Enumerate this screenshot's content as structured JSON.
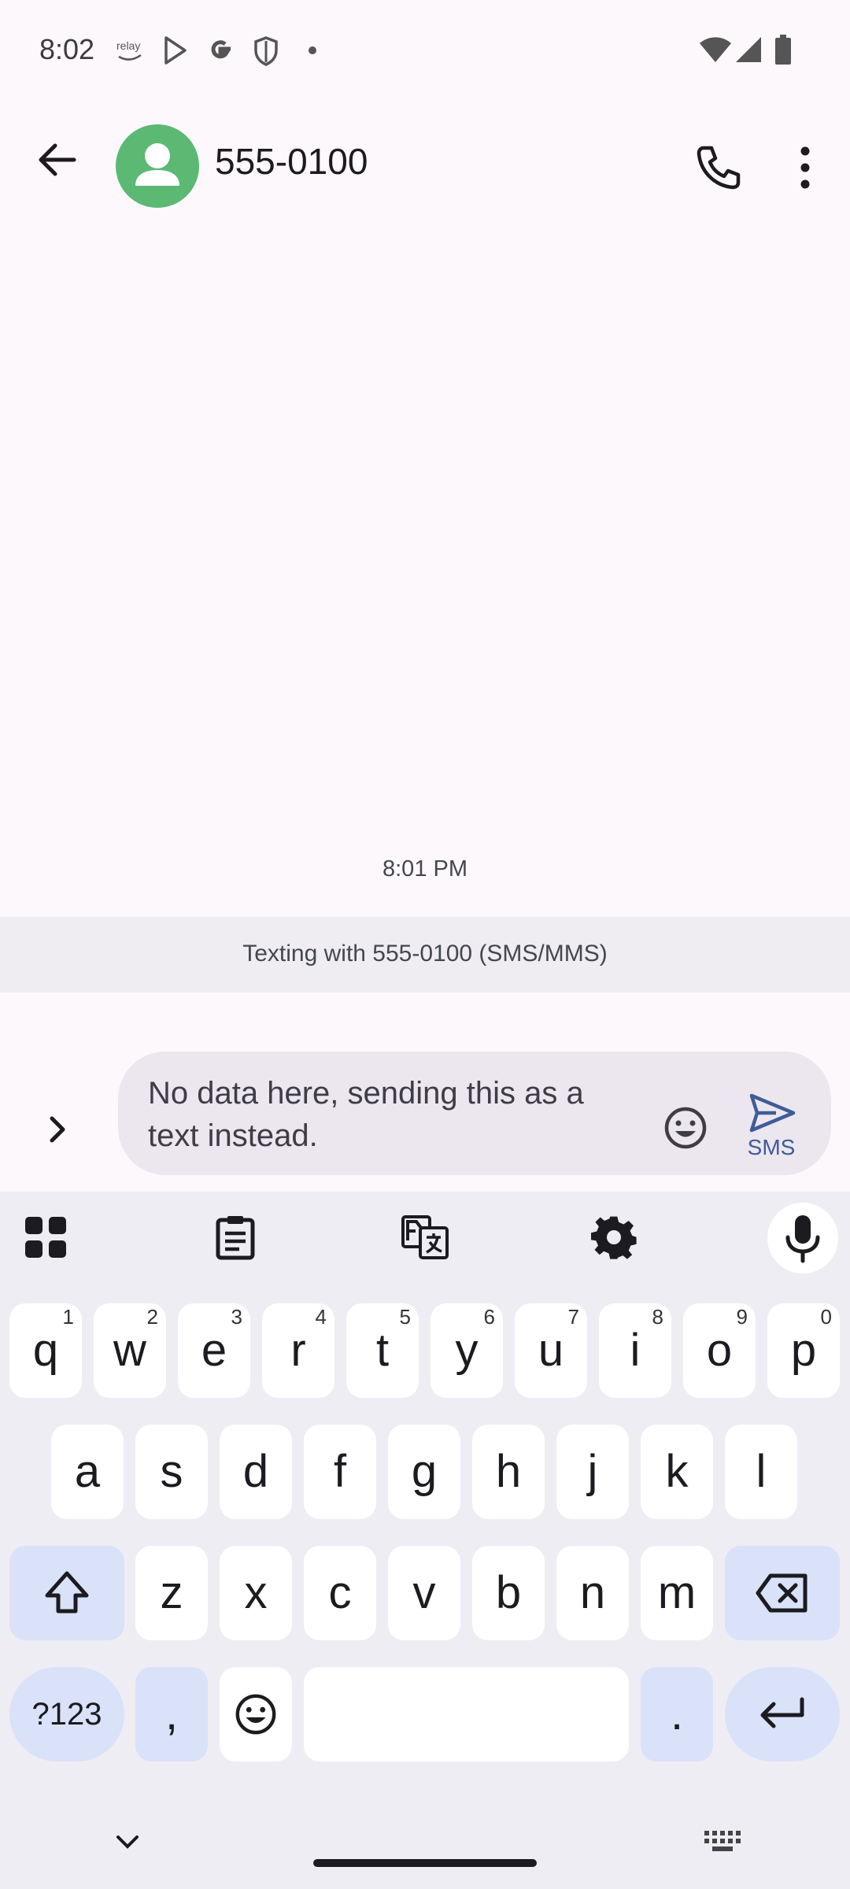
{
  "status_bar": {
    "time": "8:02",
    "left_icons": [
      "relay-icon",
      "play-store-icon",
      "google-icon",
      "shield-icon",
      "dot-icon"
    ],
    "right_icons": [
      "wifi-icon",
      "signal-icon",
      "battery-icon"
    ],
    "relay_label": "relay"
  },
  "app_bar": {
    "contact_name": "555-0100",
    "icons": [
      "back-arrow-icon",
      "avatar-person-icon",
      "phone-icon",
      "more-vert-icon"
    ]
  },
  "conversation": {
    "timestamp": "8:01 PM",
    "banner": "Texting with 555-0100 (SMS/MMS)"
  },
  "compose": {
    "message": "No data here, sending this as a text instead.",
    "send_label": "SMS"
  },
  "keyboard": {
    "row1": [
      {
        "k": "q",
        "h": "1"
      },
      {
        "k": "w",
        "h": "2"
      },
      {
        "k": "e",
        "h": "3"
      },
      {
        "k": "r",
        "h": "4"
      },
      {
        "k": "t",
        "h": "5"
      },
      {
        "k": "y",
        "h": "6"
      },
      {
        "k": "u",
        "h": "7"
      },
      {
        "k": "i",
        "h": "8"
      },
      {
        "k": "o",
        "h": "9"
      },
      {
        "k": "p",
        "h": "0"
      }
    ],
    "row2": [
      "a",
      "s",
      "d",
      "f",
      "g",
      "h",
      "j",
      "k",
      "l"
    ],
    "row3": [
      "z",
      "x",
      "c",
      "v",
      "b",
      "n",
      "m"
    ],
    "symbols_label": "?123",
    "comma_label": ",",
    "period_label": "."
  },
  "colors": {
    "avatar": "#5bb974",
    "compose_bg": "#ece6ef",
    "function_key": "#d9e2f8",
    "send_accent": "#3d5c9a"
  }
}
